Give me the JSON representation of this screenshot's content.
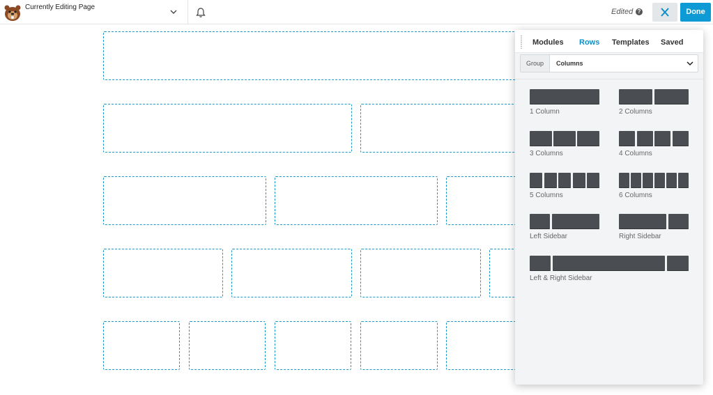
{
  "topbar": {
    "page_title": "Currently Editing Page",
    "status": "Edited",
    "help_glyph": "?",
    "done_label": "Done",
    "accent": "#0e9ad4"
  },
  "panel": {
    "tabs": [
      {
        "label": "Modules",
        "active": false
      },
      {
        "label": "Rows",
        "active": true
      },
      {
        "label": "Templates",
        "active": false
      },
      {
        "label": "Saved",
        "active": false
      }
    ],
    "group": {
      "label": "Group",
      "value": "Columns"
    },
    "layouts": [
      {
        "label": "1 Column"
      },
      {
        "label": "2 Columns"
      },
      {
        "label": "3 Columns"
      },
      {
        "label": "4 Columns"
      },
      {
        "label": "5 Columns"
      },
      {
        "label": "6 Columns"
      },
      {
        "label": "Left Sidebar"
      },
      {
        "label": "Right Sidebar"
      },
      {
        "label": "Left & Right Sidebar"
      }
    ]
  },
  "canvas": {
    "dashed_color": "#1e99c8"
  }
}
